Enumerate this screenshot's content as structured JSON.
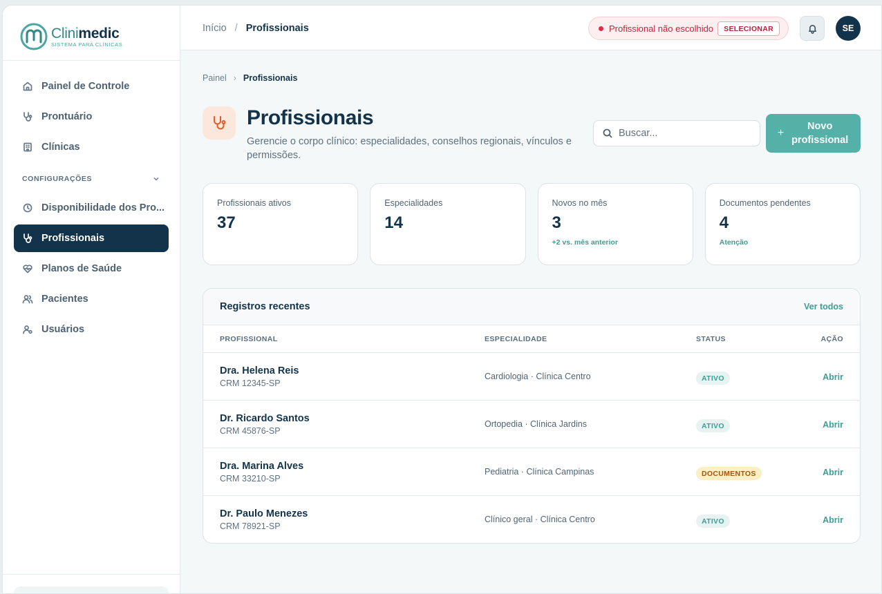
{
  "brand": {
    "name_light": "Clini",
    "name_bold": "medic",
    "tagline": "SISTEMA PARA CLÍNICAS"
  },
  "sidebar": {
    "items_top": [
      {
        "label": "Painel de Controle",
        "icon": "home-icon"
      },
      {
        "label": "Prontuário",
        "icon": "stethoscope-icon"
      },
      {
        "label": "Clínicas",
        "icon": "building-icon"
      }
    ],
    "section": "CONFIGURAÇÕES",
    "items_config": [
      {
        "label": "Disponibilidade dos Pro...",
        "icon": "clock-icon"
      },
      {
        "label": "Profissionais",
        "icon": "stethoscope-icon",
        "active": true
      },
      {
        "label": "Planos de Saúde",
        "icon": "heart-pulse-icon"
      },
      {
        "label": "Pacientes",
        "icon": "users-icon"
      },
      {
        "label": "Usuários",
        "icon": "user-cog-icon"
      }
    ]
  },
  "topbar": {
    "crumb_home": "Início",
    "crumb_sep": "/",
    "crumb_current": "Profissionais",
    "pro_status": "Profissional não escolhido",
    "pro_select": "SELECIONAR",
    "avatar": "SE"
  },
  "breadcrumb": {
    "home": "Painel",
    "chevron": "›",
    "current": "Profissionais"
  },
  "header": {
    "title": "Profissionais",
    "subtitle": "Gerencie o corpo clínico: especialidades, conselhos regionais, vínculos e permissões."
  },
  "search": {
    "placeholder": "Buscar..."
  },
  "new_button": {
    "plus": "+",
    "label": "Novo profissional"
  },
  "stats": [
    {
      "label": "Profissionais ativos",
      "value": "37",
      "note": ""
    },
    {
      "label": "Especialidades",
      "value": "14",
      "note": ""
    },
    {
      "label": "Novos no mês",
      "value": "3",
      "note": "+2 vs. mês anterior"
    },
    {
      "label": "Documentos pendentes",
      "value": "4",
      "note": "Atenção"
    }
  ],
  "recent": {
    "title": "Registros recentes",
    "view_all": "Ver todos",
    "columns": {
      "professional": "PROFISSIONAL",
      "specialty": "ESPECIALIDADE",
      "status": "STATUS",
      "action": "AÇÃO"
    },
    "rows": [
      {
        "name": "Dra. Helena Reis",
        "crm": "CRM 12345-SP",
        "specialty": "Cardiologia · Clínica Centro",
        "status": "ATIVO",
        "action": "Abrir"
      },
      {
        "name": "Dr. Ricardo Santos",
        "crm": "CRM 45876-SP",
        "specialty": "Ortopedia · Clínica Jardins",
        "status": "ATIVO",
        "action": "Abrir"
      },
      {
        "name": "Dra. Marina Alves",
        "crm": "CRM 33210-SP",
        "specialty": "Pediatria · Clínica Campinas",
        "status": "DOCUMENTOS",
        "action": "Abrir"
      },
      {
        "name": "Dr. Paulo Menezes",
        "crm": "CRM 78921-SP",
        "specialty": "Clínico geral · Clínica Centro",
        "status": "ATIVO",
        "action": "Abrir"
      }
    ]
  },
  "colors": {
    "navy": "#13334a",
    "teal": "#55b0a8",
    "accent_orange": "#e35b24",
    "alert_red": "#c2253f"
  }
}
